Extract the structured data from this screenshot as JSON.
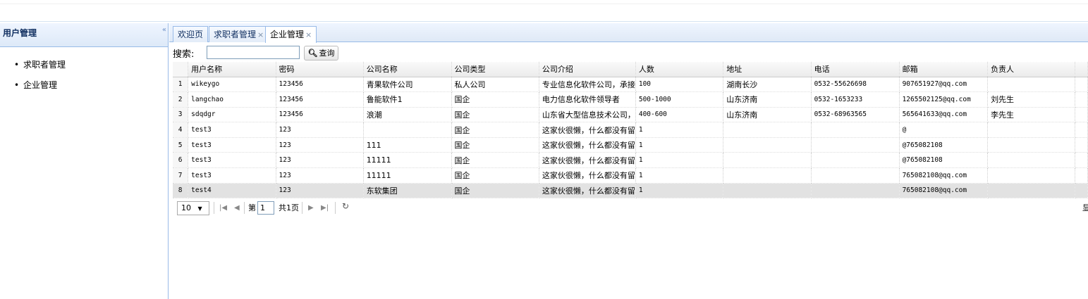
{
  "west": {
    "title": "用户管理",
    "collapse_icon": "«",
    "menu": [
      {
        "label": "求职者管理"
      },
      {
        "label": "企业管理"
      }
    ]
  },
  "tabs": [
    {
      "label": "欢迎页",
      "closable": false
    },
    {
      "label": "求职者管理",
      "closable": true
    },
    {
      "label": "企业管理",
      "closable": true,
      "active": true
    }
  ],
  "tab_close": "×",
  "search": {
    "label": "搜索:",
    "value": "",
    "button_label": "查询"
  },
  "grid": {
    "columns": [
      "用户名称",
      "密码",
      "公司名称",
      "公司类型",
      "公司介绍",
      "人数",
      "地址",
      "电话",
      "邮箱",
      "负责人"
    ],
    "rows": [
      {
        "n": "1",
        "cells": [
          "wikeygo",
          "123456",
          "青果软件公司",
          "私人公司",
          "专业信息化软件公司，承接",
          "100",
          "湖南长沙",
          "0532-55626698",
          "907651927@qq.com",
          ""
        ]
      },
      {
        "n": "2",
        "cells": [
          "langchao",
          "123456",
          "鲁能软件1",
          "国企",
          "电力信息化软件领导者",
          "500-1000",
          "山东济南",
          "0532-1653233",
          "1265502125@qq.com",
          "刘先生"
        ]
      },
      {
        "n": "3",
        "cells": [
          "sdqdgr",
          "123456",
          "浪潮",
          "国企",
          "山东省大型信息技术公司，",
          "400-600",
          "山东济南",
          "0532-68963565",
          "565641633@qq.com",
          "李先生"
        ]
      },
      {
        "n": "4",
        "cells": [
          "test3",
          "123",
          "",
          "国企",
          "这家伙很懒，什么都没有留",
          "1",
          "",
          "",
          "@",
          ""
        ]
      },
      {
        "n": "5",
        "cells": [
          "test3",
          "123",
          "111",
          "国企",
          "这家伙很懒，什么都没有留",
          "1",
          "",
          "",
          "@765082108",
          ""
        ]
      },
      {
        "n": "6",
        "cells": [
          "test3",
          "123",
          "11111",
          "国企",
          "这家伙很懒，什么都没有留",
          "1",
          "",
          "",
          "@765082108",
          ""
        ]
      },
      {
        "n": "7",
        "cells": [
          "test3",
          "123",
          "11111",
          "国企",
          "这家伙很懒，什么都没有留",
          "1",
          "",
          "",
          "765082108@qq.com",
          ""
        ]
      },
      {
        "n": "8",
        "cells": [
          "test4",
          "123",
          "东软集团",
          "国企",
          "这家伙很懒，什么都没有留",
          "1",
          "",
          "",
          "765082108@qq.com",
          ""
        ],
        "selected": true
      }
    ]
  },
  "pager": {
    "page_size": "10",
    "page_label_before": "第",
    "page_value": "1",
    "page_label_after": "共1页",
    "display_text": "显示"
  }
}
